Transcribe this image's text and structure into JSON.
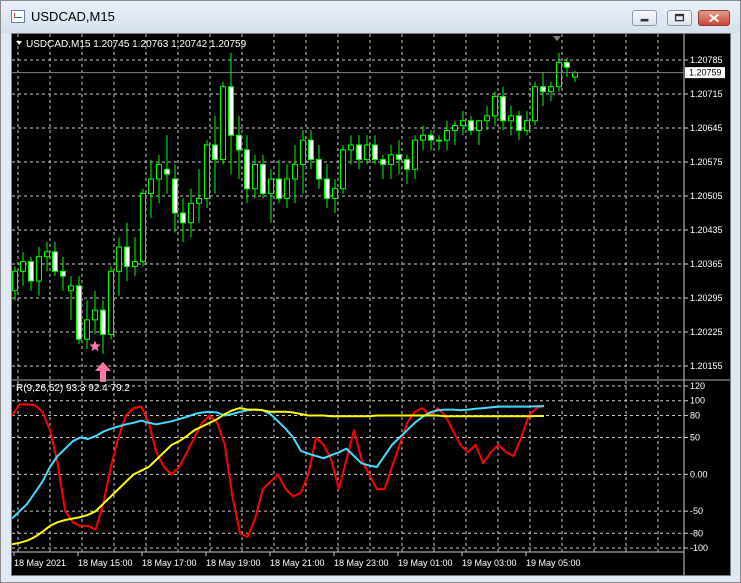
{
  "window": {
    "title": "USDCAD,M15",
    "buttons": [
      "minimize",
      "maximize",
      "close"
    ]
  },
  "chart_data": [
    {
      "type": "candlestick",
      "header": "USDCAD,M15  1.20745 1.20763 1.20742 1.20759",
      "symbol": "USDCAD",
      "timeframe": "M15",
      "ohlc_last": [
        1.20745,
        1.20763,
        1.20742,
        1.20759
      ],
      "current_price_label": "1.20759",
      "current_price": 1.20759,
      "y_ticks": [
        1.20785,
        1.20715,
        1.20645,
        1.20575,
        1.20505,
        1.20435,
        1.20365,
        1.20295,
        1.20225,
        1.20155
      ],
      "ylim": [
        1.2015,
        1.2081
      ],
      "grid": true,
      "colors": {
        "background": "#000000",
        "bull": "#000000",
        "bull_stroke": "#00ff00",
        "bear": "#ffffff",
        "bear_stroke": "#00ff00",
        "grid": "#c8c8c8",
        "axis_text": "#ffffff"
      },
      "candles": [
        [
          1.2031,
          1.2036,
          1.2029,
          1.2035
        ],
        [
          1.2035,
          1.2039,
          1.2032,
          1.2037
        ],
        [
          1.2037,
          1.2038,
          1.2031,
          1.2033
        ],
        [
          1.2033,
          1.204,
          1.203,
          1.2038
        ],
        [
          1.2038,
          1.2041,
          1.2035,
          1.2039
        ],
        [
          1.2039,
          1.2041,
          1.2034,
          1.2035
        ],
        [
          1.2035,
          1.2038,
          1.2031,
          1.2034
        ],
        [
          1.2031,
          1.2034,
          1.2025,
          1.2032
        ],
        [
          1.2032,
          1.2034,
          1.202,
          1.2021
        ],
        [
          1.2021,
          1.2029,
          1.2019,
          1.2025
        ],
        [
          1.2025,
          1.2031,
          1.2022,
          1.2027
        ],
        [
          1.2027,
          1.2029,
          1.2018,
          1.2022
        ],
        [
          1.2022,
          1.2036,
          1.2021,
          1.2035
        ],
        [
          1.2035,
          1.2042,
          1.203,
          1.204
        ],
        [
          1.204,
          1.2045,
          1.2033,
          1.2036
        ],
        [
          1.2036,
          1.2042,
          1.2034,
          1.2037
        ],
        [
          1.2037,
          1.2052,
          1.2036,
          1.2051
        ],
        [
          1.2051,
          1.2058,
          1.2046,
          1.2054
        ],
        [
          1.2054,
          1.2059,
          1.2049,
          1.2057
        ],
        [
          1.2056,
          1.2063,
          1.2051,
          1.2055
        ],
        [
          1.2054,
          1.2057,
          1.2043,
          1.2047
        ],
        [
          1.2047,
          1.205,
          1.2041,
          1.2045
        ],
        [
          1.2045,
          1.2052,
          1.2042,
          1.2049
        ],
        [
          1.2049,
          1.2056,
          1.2045,
          1.205
        ],
        [
          1.205,
          1.2062,
          1.2048,
          1.2061
        ],
        [
          1.2061,
          1.2067,
          1.2051,
          1.2058
        ],
        [
          1.2058,
          1.2074,
          1.2057,
          1.2073
        ],
        [
          1.2073,
          1.208,
          1.2055,
          1.2063
        ],
        [
          1.2063,
          1.2067,
          1.2054,
          1.206
        ],
        [
          1.206,
          1.2063,
          1.2049,
          1.2052
        ],
        [
          1.2052,
          1.2059,
          1.205,
          1.2057
        ],
        [
          1.2057,
          1.2059,
          1.205,
          1.2051
        ],
        [
          1.2051,
          1.2056,
          1.2045,
          1.2054
        ],
        [
          1.2054,
          1.2058,
          1.2049,
          1.205
        ],
        [
          1.205,
          1.2057,
          1.2048,
          1.2054
        ],
        [
          1.2054,
          1.2061,
          1.2049,
          1.2057
        ],
        [
          1.2057,
          1.2064,
          1.2051,
          1.2062
        ],
        [
          1.2062,
          1.2064,
          1.2056,
          1.2058
        ],
        [
          1.2058,
          1.2061,
          1.2052,
          1.2054
        ],
        [
          1.2054,
          1.2057,
          1.2048,
          1.205
        ],
        [
          1.205,
          1.2054,
          1.2047,
          1.2052
        ],
        [
          1.2052,
          1.2061,
          1.2051,
          1.206
        ],
        [
          1.206,
          1.2063,
          1.2057,
          1.2061
        ],
        [
          1.2061,
          1.2063,
          1.2056,
          1.2058
        ],
        [
          1.2058,
          1.2063,
          1.2057,
          1.2061
        ],
        [
          1.2061,
          1.2063,
          1.2057,
          1.2058
        ],
        [
          1.2058,
          1.2059,
          1.2054,
          1.2057
        ],
        [
          1.2057,
          1.2061,
          1.2054,
          1.2059
        ],
        [
          1.2059,
          1.2062,
          1.2055,
          1.2058
        ],
        [
          1.2058,
          1.2059,
          1.2053,
          1.2056
        ],
        [
          1.2056,
          1.2063,
          1.2054,
          1.2062
        ],
        [
          1.2062,
          1.2065,
          1.206,
          1.2063
        ],
        [
          1.2063,
          1.2064,
          1.206,
          1.2062
        ],
        [
          1.2062,
          1.2063,
          1.206,
          1.2062
        ],
        [
          1.2062,
          1.2066,
          1.206,
          1.2064
        ],
        [
          1.2064,
          1.2066,
          1.2061,
          1.2065
        ],
        [
          1.2065,
          1.2068,
          1.2063,
          1.2066
        ],
        [
          1.2066,
          1.2067,
          1.2063,
          1.2064
        ],
        [
          1.2064,
          1.2066,
          1.2061,
          1.2066
        ],
        [
          1.2066,
          1.2069,
          1.2064,
          1.2067
        ],
        [
          1.2067,
          1.2072,
          1.2065,
          1.2071
        ],
        [
          1.2071,
          1.2073,
          1.2064,
          1.2066
        ],
        [
          1.2066,
          1.2069,
          1.2063,
          1.2067
        ],
        [
          1.2067,
          1.2068,
          1.2062,
          1.2064
        ],
        [
          1.2064,
          1.2068,
          1.2063,
          1.2066
        ],
        [
          1.2066,
          1.2074,
          1.2065,
          1.2073
        ],
        [
          1.2073,
          1.2076,
          1.2069,
          1.2072
        ],
        [
          1.2072,
          1.2074,
          1.207,
          1.2073
        ],
        [
          1.2073,
          1.208,
          1.2072,
          1.2078
        ],
        [
          1.2078,
          1.2079,
          1.2075,
          1.2077
        ],
        [
          1.2075,
          1.20763,
          1.2074,
          1.20759
        ]
      ],
      "markers": [
        {
          "type": "star",
          "candle_index": 10,
          "color": "#ff77aa"
        },
        {
          "type": "arrow-up",
          "candle_index": 11,
          "color": "#ff77aa"
        }
      ]
    },
    {
      "type": "line",
      "indicator_label": "R(9,26,52) 93.3 92.4 79.2",
      "y_ticks": [
        120,
        100,
        80,
        50,
        0.0,
        -50,
        -80,
        -100
      ],
      "ylim": [
        -105,
        125
      ],
      "x_tick_labels": [
        "18 May 2021",
        "18 May 15:00",
        "18 May 17:00",
        "18 May 19:00",
        "18 May 21:00",
        "18 May 23:00",
        "19 May 01:00",
        "19 May 03:00",
        "19 May 05:00"
      ],
      "series": [
        {
          "color": "#ff0000",
          "last": 93.3,
          "values": [
            80,
            95,
            95,
            94,
            85,
            60,
            15,
            -50,
            -65,
            -70,
            -70,
            -75,
            -40,
            10,
            50,
            80,
            90,
            92,
            70,
            30,
            10,
            0,
            10,
            30,
            50,
            70,
            80,
            70,
            40,
            -30,
            -80,
            -85,
            -60,
            -20,
            -10,
            0,
            -20,
            -30,
            -25,
            0,
            50,
            40,
            20,
            -20,
            20,
            60,
            20,
            0,
            -20,
            -20,
            10,
            40,
            70,
            85,
            90,
            80,
            90,
            80,
            60,
            40,
            30,
            40,
            15,
            30,
            40,
            30,
            25,
            50,
            80,
            90,
            93.3
          ]
        },
        {
          "color": "#44ddff",
          "last": 92.4,
          "values": [
            -60,
            -50,
            -40,
            -25,
            -10,
            10,
            25,
            35,
            45,
            50,
            48,
            52,
            58,
            62,
            65,
            68,
            70,
            73,
            70,
            68,
            70,
            72,
            75,
            78,
            82,
            84,
            85,
            84,
            80,
            82,
            85,
            87,
            88,
            87,
            82,
            72,
            62,
            50,
            32,
            28,
            25,
            22,
            26,
            30,
            35,
            25,
            15,
            12,
            10,
            25,
            40,
            50,
            60,
            70,
            78,
            84,
            87,
            88,
            88,
            87,
            88,
            89,
            90,
            91,
            92,
            92,
            92,
            92,
            92,
            92.4,
            92.4
          ]
        },
        {
          "color": "#ffff00",
          "last": 79.2,
          "values": [
            -95,
            -93,
            -90,
            -85,
            -78,
            -70,
            -65,
            -62,
            -60,
            -58,
            -55,
            -50,
            -40,
            -30,
            -20,
            -10,
            0,
            5,
            10,
            20,
            30,
            40,
            45,
            52,
            60,
            65,
            70,
            75,
            82,
            87,
            90,
            88,
            88,
            87,
            85,
            85,
            85,
            84,
            82,
            80,
            80,
            80,
            79,
            79,
            79,
            79,
            79,
            79,
            80,
            80,
            80,
            80,
            80,
            80,
            80,
            80,
            80,
            79,
            79,
            79,
            79,
            79,
            79,
            79,
            79,
            79,
            79,
            79,
            79,
            79.2,
            79.2
          ]
        }
      ]
    }
  ]
}
